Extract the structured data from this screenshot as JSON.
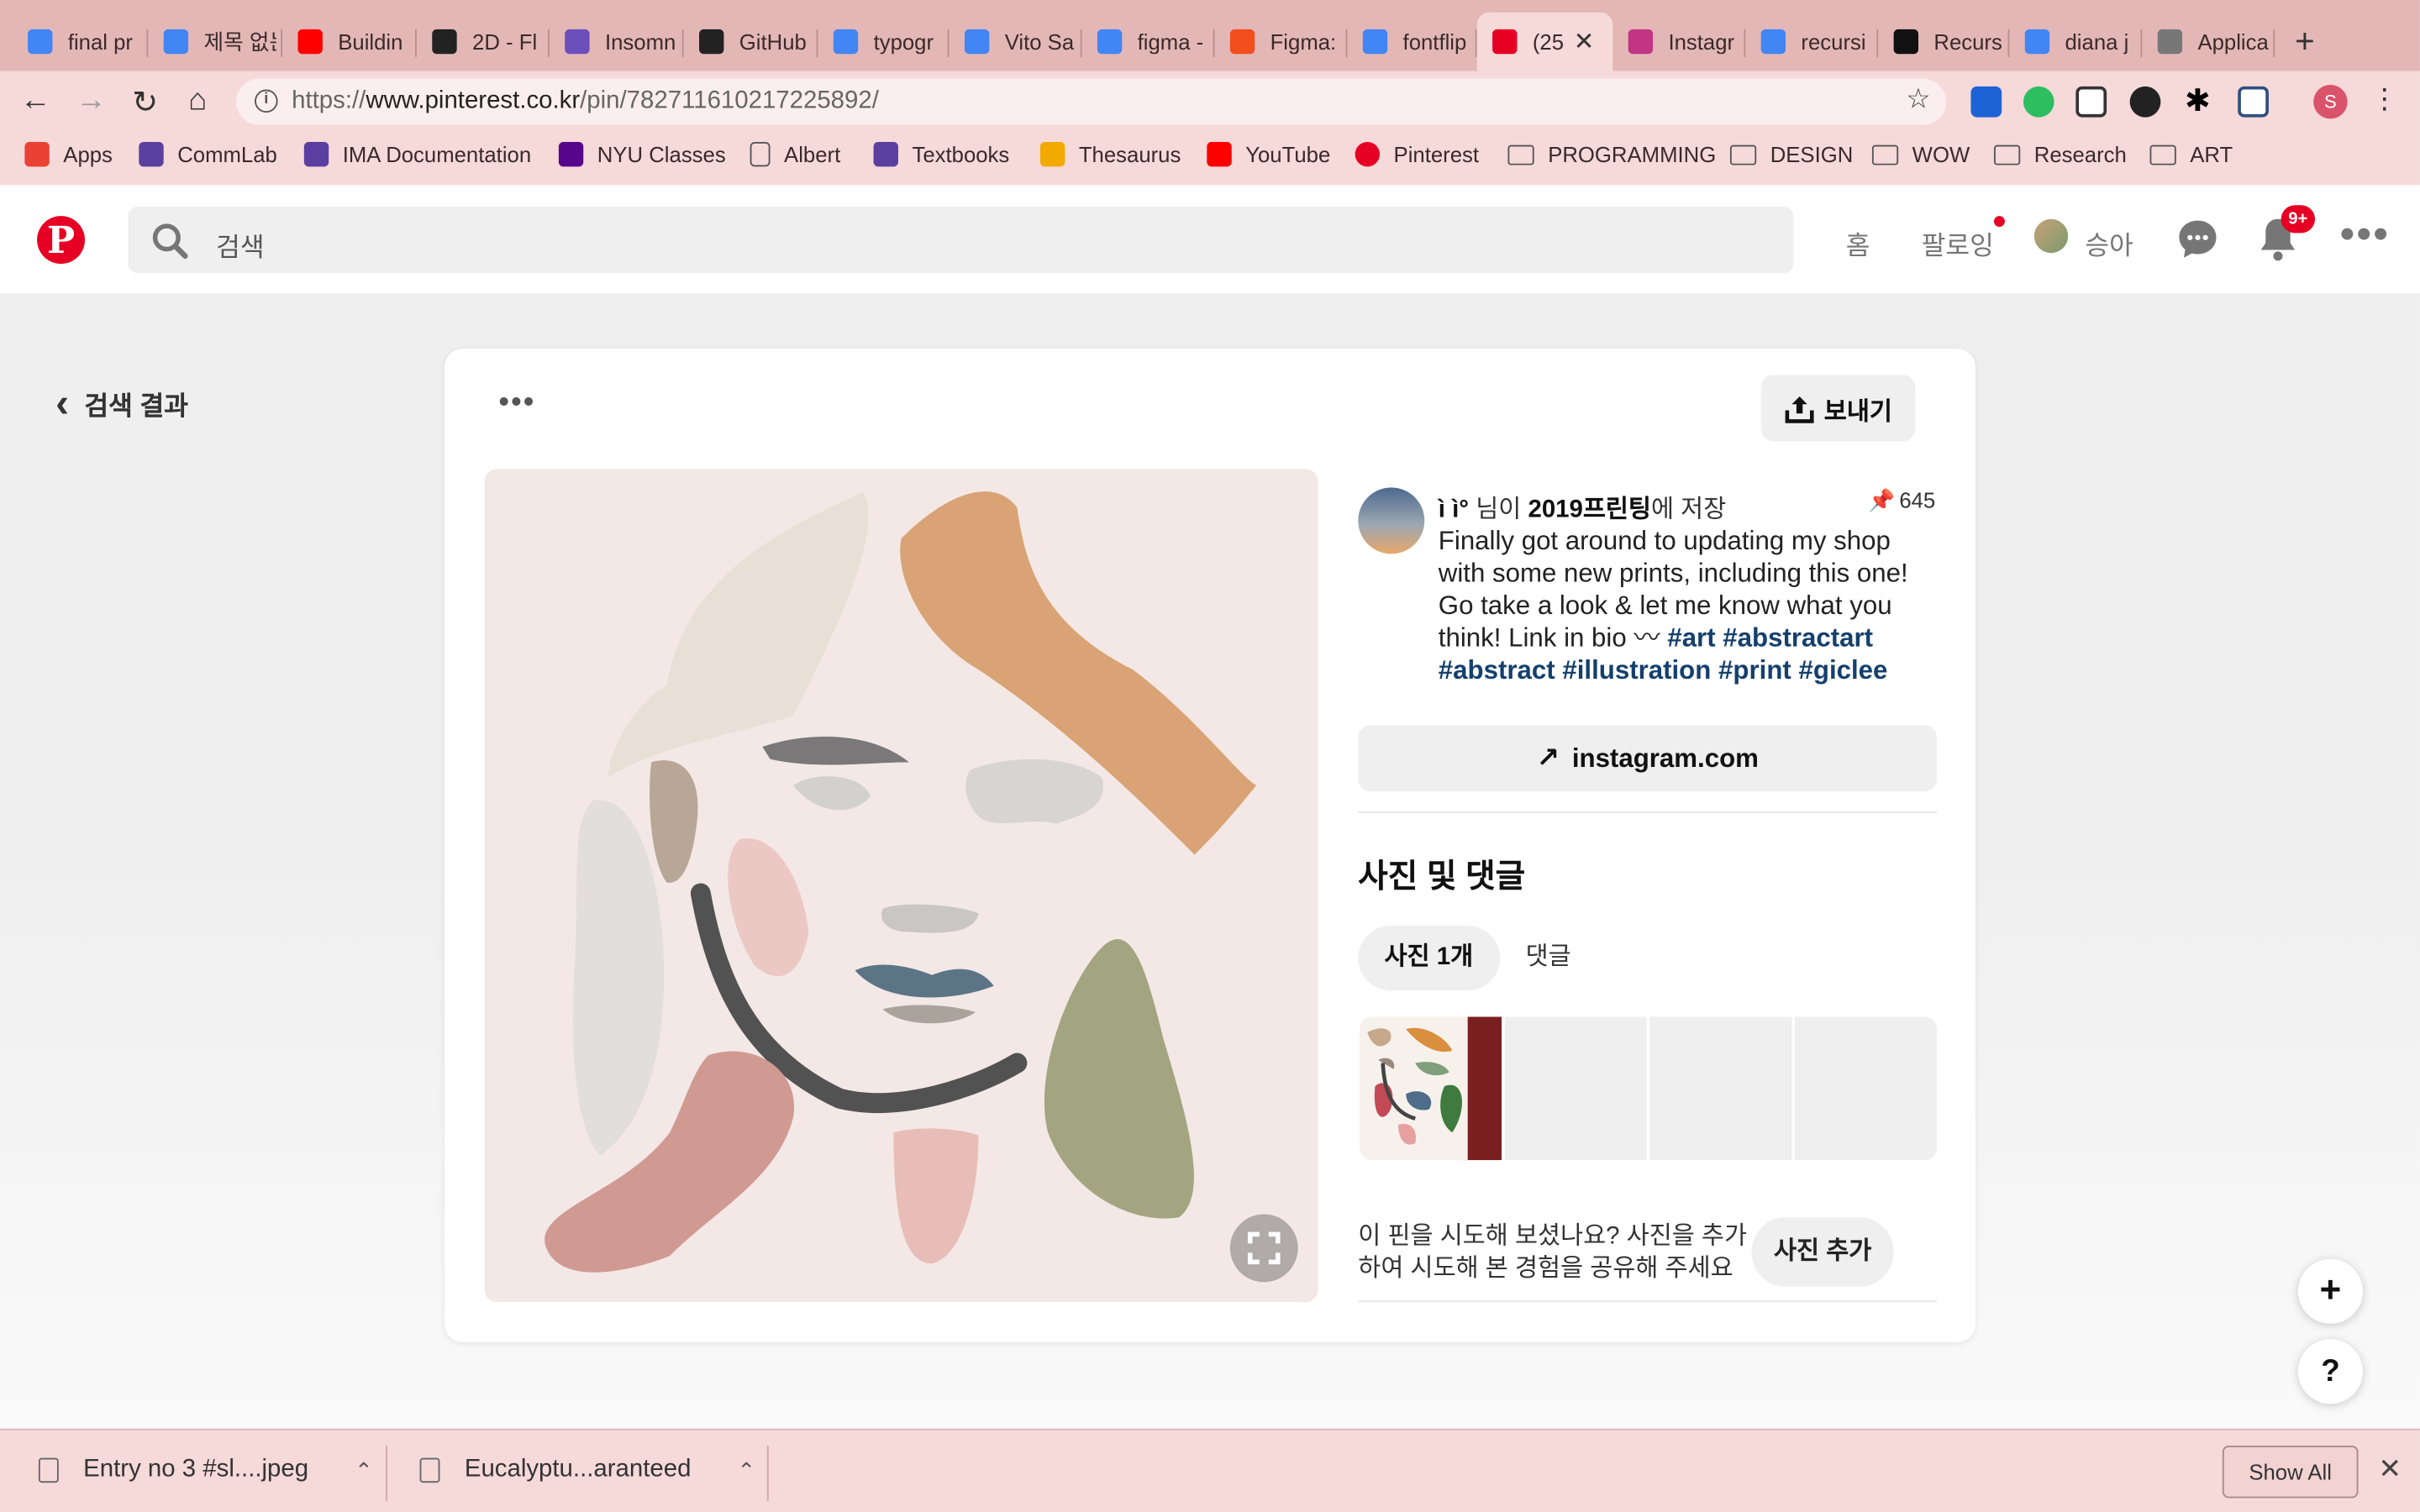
{
  "browser": {
    "tabs": [
      {
        "title": "final pr",
        "favicon": "docs-icon",
        "color": "#4285f4"
      },
      {
        "title": "제목 없는",
        "favicon": "docs-icon",
        "color": "#4285f4"
      },
      {
        "title": "Buildin",
        "favicon": "youtube-icon",
        "color": "#ff0000"
      },
      {
        "title": "2D - Fl",
        "favicon": "2d-icon",
        "color": "#222222"
      },
      {
        "title": "Insomn",
        "favicon": "insomnia-icon",
        "color": "#6b4fbb"
      },
      {
        "title": "GitHub",
        "favicon": "github-icon",
        "color": "#222222"
      },
      {
        "title": "typogr",
        "favicon": "google-icon",
        "color": "#4285f4"
      },
      {
        "title": "Vito Sa",
        "favicon": "google-icon",
        "color": "#4285f4"
      },
      {
        "title": "figma -",
        "favicon": "google-icon",
        "color": "#4285f4"
      },
      {
        "title": "Figma:",
        "favicon": "figma-icon",
        "color": "#f24e1e"
      },
      {
        "title": "fontflip",
        "favicon": "google-icon",
        "color": "#4285f4"
      },
      {
        "title": "(25",
        "favicon": "pinterest-icon",
        "color": "#e60023",
        "active": true
      },
      {
        "title": "Instagr",
        "favicon": "instagram-icon",
        "color": "#c13584"
      },
      {
        "title": "recursi",
        "favicon": "google-icon",
        "color": "#4285f4"
      },
      {
        "title": "Recurs",
        "favicon": "medium-icon",
        "color": "#111111"
      },
      {
        "title": "diana j",
        "favicon": "google-icon",
        "color": "#4285f4"
      },
      {
        "title": "Applica",
        "favicon": "page-icon",
        "color": "#777777"
      }
    ],
    "url_prefix": "https://",
    "url_host": "www.pinterest.co.kr",
    "url_path": "/pin/782711610217225892/",
    "profile_initial": "S",
    "bookmarks": [
      {
        "label": "Apps",
        "icon": "apps-grid-icon"
      },
      {
        "label": "CommLab",
        "icon": "commlab-icon"
      },
      {
        "label": "IMA Documentation",
        "icon": "ima-icon"
      },
      {
        "label": "NYU Classes",
        "icon": "nyu-icon"
      },
      {
        "label": "Albert",
        "icon": "page-icon"
      },
      {
        "label": "Textbooks",
        "icon": "textbooks-icon"
      },
      {
        "label": "Thesaurus",
        "icon": "thesaurus-icon"
      },
      {
        "label": "YouTube",
        "icon": "youtube-icon"
      },
      {
        "label": "Pinterest",
        "icon": "pinterest-icon"
      },
      {
        "label": "PROGRAMMING",
        "icon": "folder-icon"
      },
      {
        "label": "DESIGN",
        "icon": "folder-icon"
      },
      {
        "label": "WOW",
        "icon": "folder-icon"
      },
      {
        "label": "Research",
        "icon": "folder-icon"
      },
      {
        "label": "ART",
        "icon": "folder-icon"
      }
    ]
  },
  "pinterest": {
    "logo": "P",
    "search_placeholder": "검색",
    "nav_home": "홈",
    "nav_following": "팔로잉",
    "user_name": "승아",
    "notifications_badge": "9+",
    "back_label": "검색 결과",
    "send_label": "보내기",
    "pinner_name": "ì ì°",
    "saved_mid": " 님이 ",
    "board_name": "2019프린팅",
    "saved_suffix": "에 저장",
    "pin_count": "645",
    "description": "Finally got around to updating my shop with some new prints, including this one! Go take a look & let me know what you think! Link in bio 〰",
    "hashtags": [
      "#art",
      "#abstractart",
      "#abstract",
      "#illustration",
      "#print",
      "#giclee"
    ],
    "link_label": "instagram.com",
    "section_title": "사진 및 댓글",
    "tab_photos": "사진 1개",
    "tab_comments": "댓글",
    "try_prompt": "이 핀을 시도해 보셨나요? 사진을 추가하여 시도해 본 경험을 공유해 주세요",
    "add_photo_label": "사진 추가",
    "fab_add": "+",
    "fab_help": "?"
  },
  "downloads": {
    "items": [
      "Entry no 3 #sl....jpeg",
      "Eucalyptu...aranteed"
    ],
    "show_all": "Show All"
  }
}
